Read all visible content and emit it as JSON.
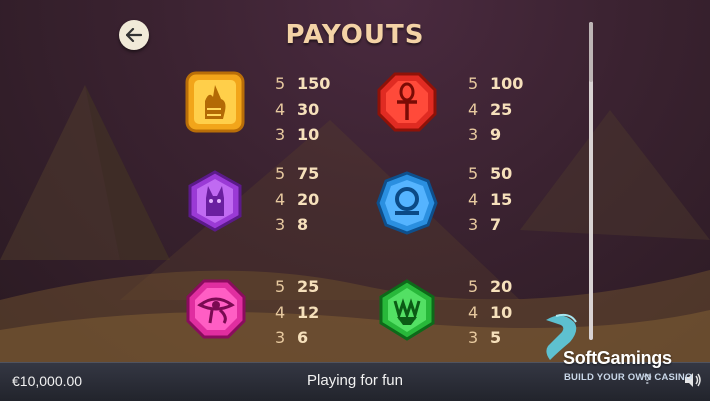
{
  "header": {
    "title": "PAYOUTS"
  },
  "symbols": [
    {
      "name": "anubis",
      "color": "#f2a51a",
      "payouts": [
        {
          "count": "5",
          "value": "150"
        },
        {
          "count": "4",
          "value": "30"
        },
        {
          "count": "3",
          "value": "10"
        }
      ]
    },
    {
      "name": "ankh",
      "color": "#e02b22",
      "payouts": [
        {
          "count": "5",
          "value": "100"
        },
        {
          "count": "4",
          "value": "25"
        },
        {
          "count": "3",
          "value": "9"
        }
      ]
    },
    {
      "name": "cat",
      "color": "#9a3ad6",
      "payouts": [
        {
          "count": "5",
          "value": "75"
        },
        {
          "count": "4",
          "value": "20"
        },
        {
          "count": "3",
          "value": "8"
        }
      ]
    },
    {
      "name": "shen-ring",
      "color": "#2a8fe0",
      "payouts": [
        {
          "count": "5",
          "value": "50"
        },
        {
          "count": "4",
          "value": "15"
        },
        {
          "count": "3",
          "value": "7"
        }
      ]
    },
    {
      "name": "eye-of-horus",
      "color": "#e02ea0",
      "payouts": [
        {
          "count": "5",
          "value": "25"
        },
        {
          "count": "4",
          "value": "12"
        },
        {
          "count": "3",
          "value": "6"
        }
      ]
    },
    {
      "name": "lotus",
      "color": "#28b83a",
      "payouts": [
        {
          "count": "5",
          "value": "20"
        },
        {
          "count": "4",
          "value": "10"
        },
        {
          "count": "3",
          "value": "5"
        }
      ]
    }
  ],
  "footer": {
    "balance": "€10,000.00",
    "mode": "Playing for fun",
    "help": "?"
  },
  "branding": {
    "name": "SoftGamings",
    "tagline": "BUILD YOUR OWN CASINO"
  }
}
